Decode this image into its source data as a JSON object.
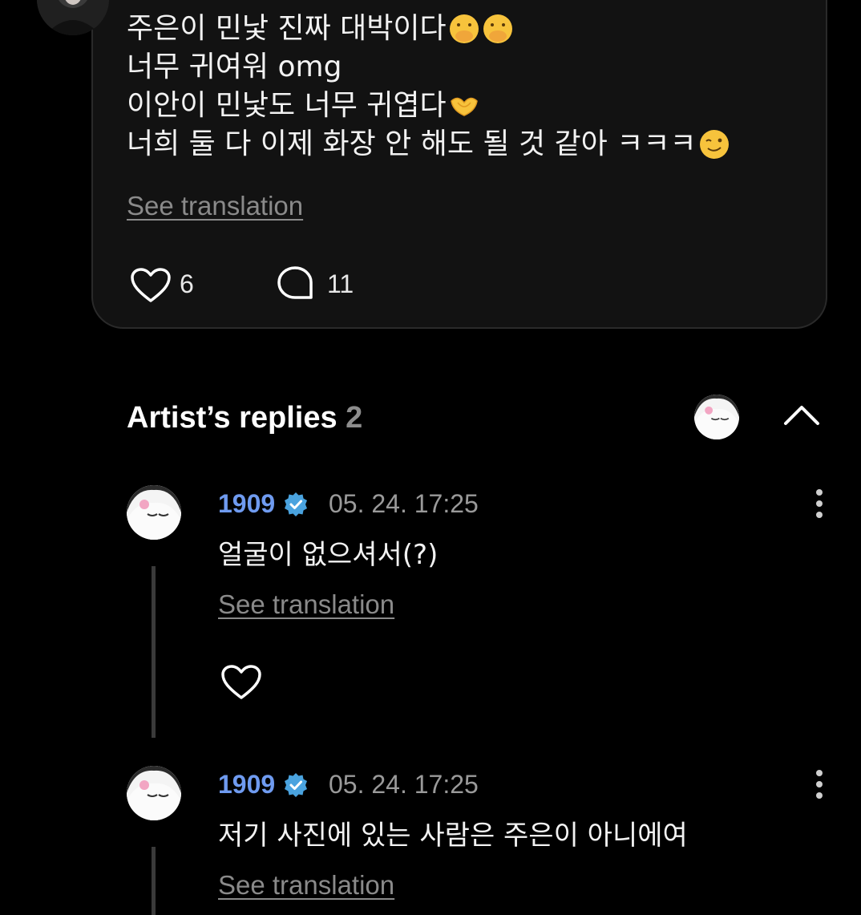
{
  "post": {
    "lines": [
      "주은이 민낯 진짜 대박이다",
      "너무 귀여워 omg",
      "이안이 민낯도 너무 귀엽다",
      "너희 둘 다 이제 화장 안 해도 될 것 같아 ㅋㅋㅋ"
    ],
    "see_translation": "See translation",
    "like_count": "6",
    "comment_count": "11"
  },
  "artist_replies": {
    "title": "Artist’s replies",
    "count": "2"
  },
  "replies": [
    {
      "name": "1909",
      "time": "05. 24. 17:25",
      "text": "얼굴이 없으셔서(?)",
      "see_translation": "See translation"
    },
    {
      "name": "1909",
      "time": "05. 24. 17:25",
      "text": "저기 사진에 있는 사람은 주은이 아니에여",
      "see_translation": "See translation"
    }
  ],
  "colors": {
    "background": "#000000",
    "card": "#121212",
    "artist_name": "#6f9bf0",
    "verified_badge": "#4aa3df",
    "muted_text": "#8a8a8a"
  }
}
